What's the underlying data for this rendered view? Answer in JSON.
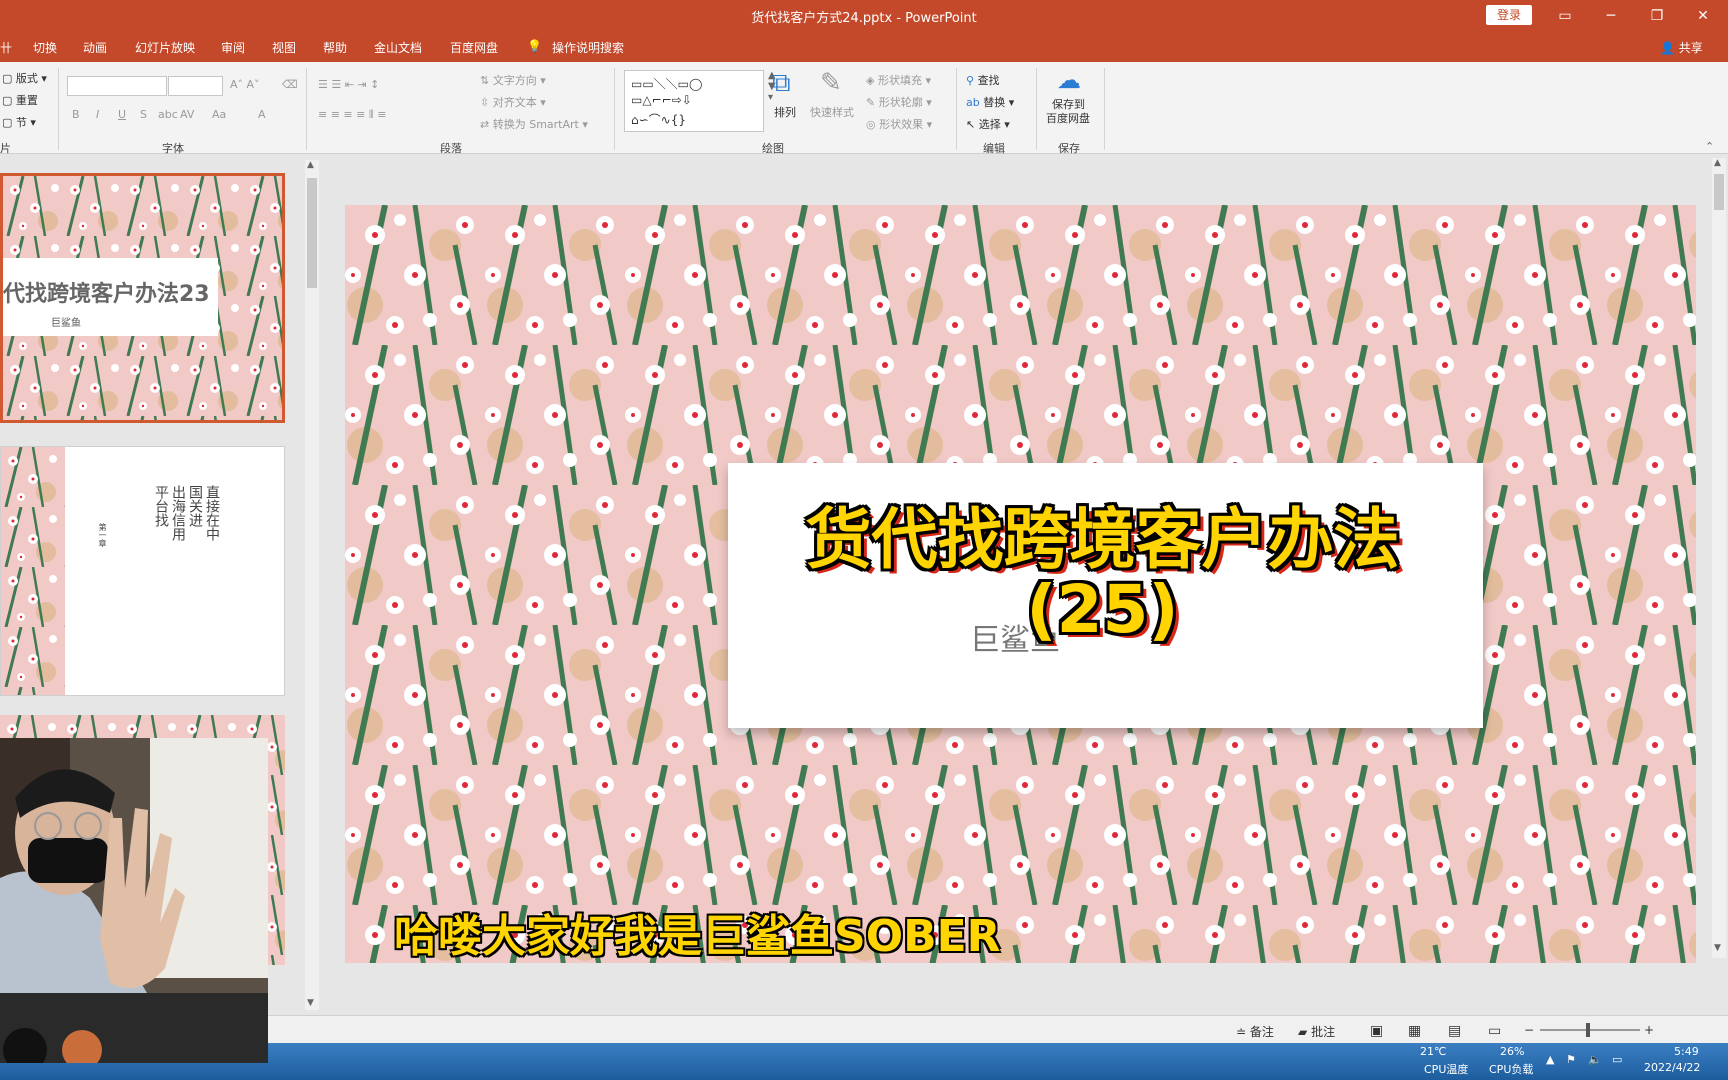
{
  "window": {
    "title": "货代找客户方式24.pptx - PowerPoint",
    "login": "登录"
  },
  "tabs": [
    "切换",
    "动画",
    "幻灯片放映",
    "审阅",
    "视图",
    "帮助",
    "金山文档",
    "百度网盘",
    "操作说明搜索"
  ],
  "share_label": "共享",
  "ribbon": {
    "slides_group": {
      "layout": "版式",
      "reset": "重置",
      "section": "节",
      "label": "片"
    },
    "font_group": {
      "label": "字体",
      "bold": "B",
      "italic": "I",
      "underline": "U",
      "shadow": "S",
      "strike": "abc",
      "spacing": "AV",
      "case": "Aa",
      "color": "A"
    },
    "paragraph_group": {
      "label": "段落",
      "text_direction": "文字方向",
      "align_text": "对齐文本",
      "smartart": "转换为 SmartArt"
    },
    "drawing_group": {
      "label": "绘图",
      "arrange": "排列",
      "quick_styles": "快速样式",
      "shape_fill": "形状填充",
      "shape_outline": "形状轮廓",
      "shape_effects": "形状效果"
    },
    "editing_group": {
      "label": "编辑",
      "find": "查找",
      "replace": "替换",
      "select": "选择"
    },
    "save_group": {
      "label": "保存",
      "save_line1": "保存到",
      "save_line2": "百度网盘"
    }
  },
  "thumbnails": {
    "slide1": {
      "title": "代找跨境客户办法23",
      "subtitle": "巨鲨鱼"
    },
    "slide2": {
      "col1": "直接在中",
      "col2": "国关进",
      "col3": "出海信用",
      "col4": "平台找",
      "chapter": "第一章"
    }
  },
  "slide": {
    "subtitle": "巨鲨鱼",
    "overlay_title_line1": "货代找跨境客户办法",
    "overlay_title_line2": "(25)",
    "caption": "哈喽大家好我是巨鲨鱼SOBER"
  },
  "status": {
    "notes": "备注",
    "comments": "批注"
  },
  "taskbar": {
    "temp_value": "21℃",
    "temp_label": "CPU温度",
    "cpu_value": "26%",
    "cpu_label": "CPU负载",
    "time": "5:49",
    "date": "2022/4/22"
  },
  "colors": {
    "accent": "#c4482a",
    "selected_border": "#d1592f",
    "overlay_yellow": "#ffd400"
  }
}
